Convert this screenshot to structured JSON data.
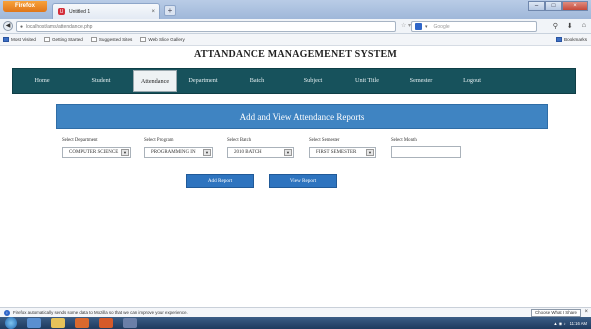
{
  "browser": {
    "firefox_button": "Firefox",
    "tab_title": "Untitled 1",
    "url": "localhost/ams/attendance.php",
    "search_placeholder": "Google",
    "bookmarks": [
      "Most Visited",
      "Getting Started",
      "Suggested Sites",
      "Web Slice Gallery"
    ],
    "bookmarks_right": "Bookmarks"
  },
  "page": {
    "title": "ATTANDANCE MANAGEMENET SYSTEM",
    "nav": [
      "Home",
      "Student",
      "Attendance",
      "Department",
      "Batch",
      "Subject",
      "Unit Title",
      "Semester",
      "Logout"
    ],
    "active_nav": "Attendance",
    "banner": "Add and View Attendance Reports",
    "filters": {
      "department": {
        "label": "Select Department",
        "value": "COMPUTER SCIENCE"
      },
      "program": {
        "label": "Select Program",
        "value": "PROGRAMMING IN"
      },
      "batch": {
        "label": "Select Batch",
        "value": "2010 BATCH"
      },
      "semester": {
        "label": "Select Semester",
        "value": "FIRST SEMESTER"
      },
      "month": {
        "label": "Select Month",
        "value": ""
      }
    },
    "buttons": {
      "add": "Add Report",
      "view": "View Report"
    }
  },
  "notification": {
    "text": "Firefox automatically sends some data to Mozilla so that we can improve your experience.",
    "share_button": "Choose What I Share"
  },
  "taskbar": {
    "time": "11:16 AM"
  },
  "colors": {
    "nav_bg": "#17525c",
    "banner_bg": "#3f84c2",
    "button_bg": "#2e74bf"
  }
}
